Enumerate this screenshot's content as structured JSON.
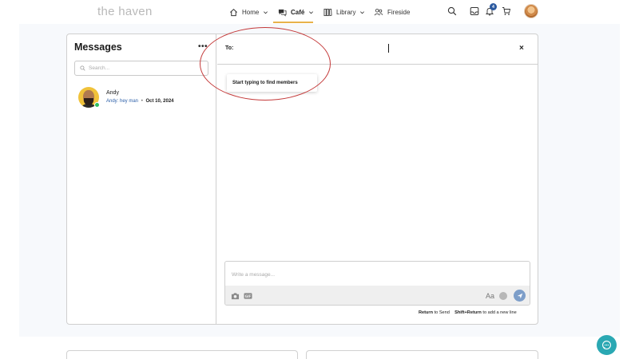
{
  "brand": "the haven",
  "nav": {
    "home": "Home",
    "cafe": "Café",
    "library": "Library",
    "fireside": "Fireside",
    "notification_count": "4"
  },
  "messages": {
    "title": "Messages",
    "more": "•••",
    "search_placeholder": "Search...",
    "conversations": [
      {
        "name": "Andy",
        "preview": "Andy: hey man",
        "separator": "•",
        "date": "Oct 10, 2024"
      }
    ]
  },
  "compose": {
    "to_label": "To:",
    "close": "×",
    "suggestion": "Start typing to find members",
    "message_placeholder": "Write a message...",
    "font_button": "Aa",
    "hint_return": "Return",
    "hint_send": "to Send",
    "hint_shift": "Shift+Return",
    "hint_newline": "to add a new line"
  },
  "colors": {
    "accent": "#e8b24a",
    "link": "#2b5ea8",
    "online": "#2fbf5f",
    "fab": "#2aa8b3",
    "annotation": "#c43a3a"
  }
}
